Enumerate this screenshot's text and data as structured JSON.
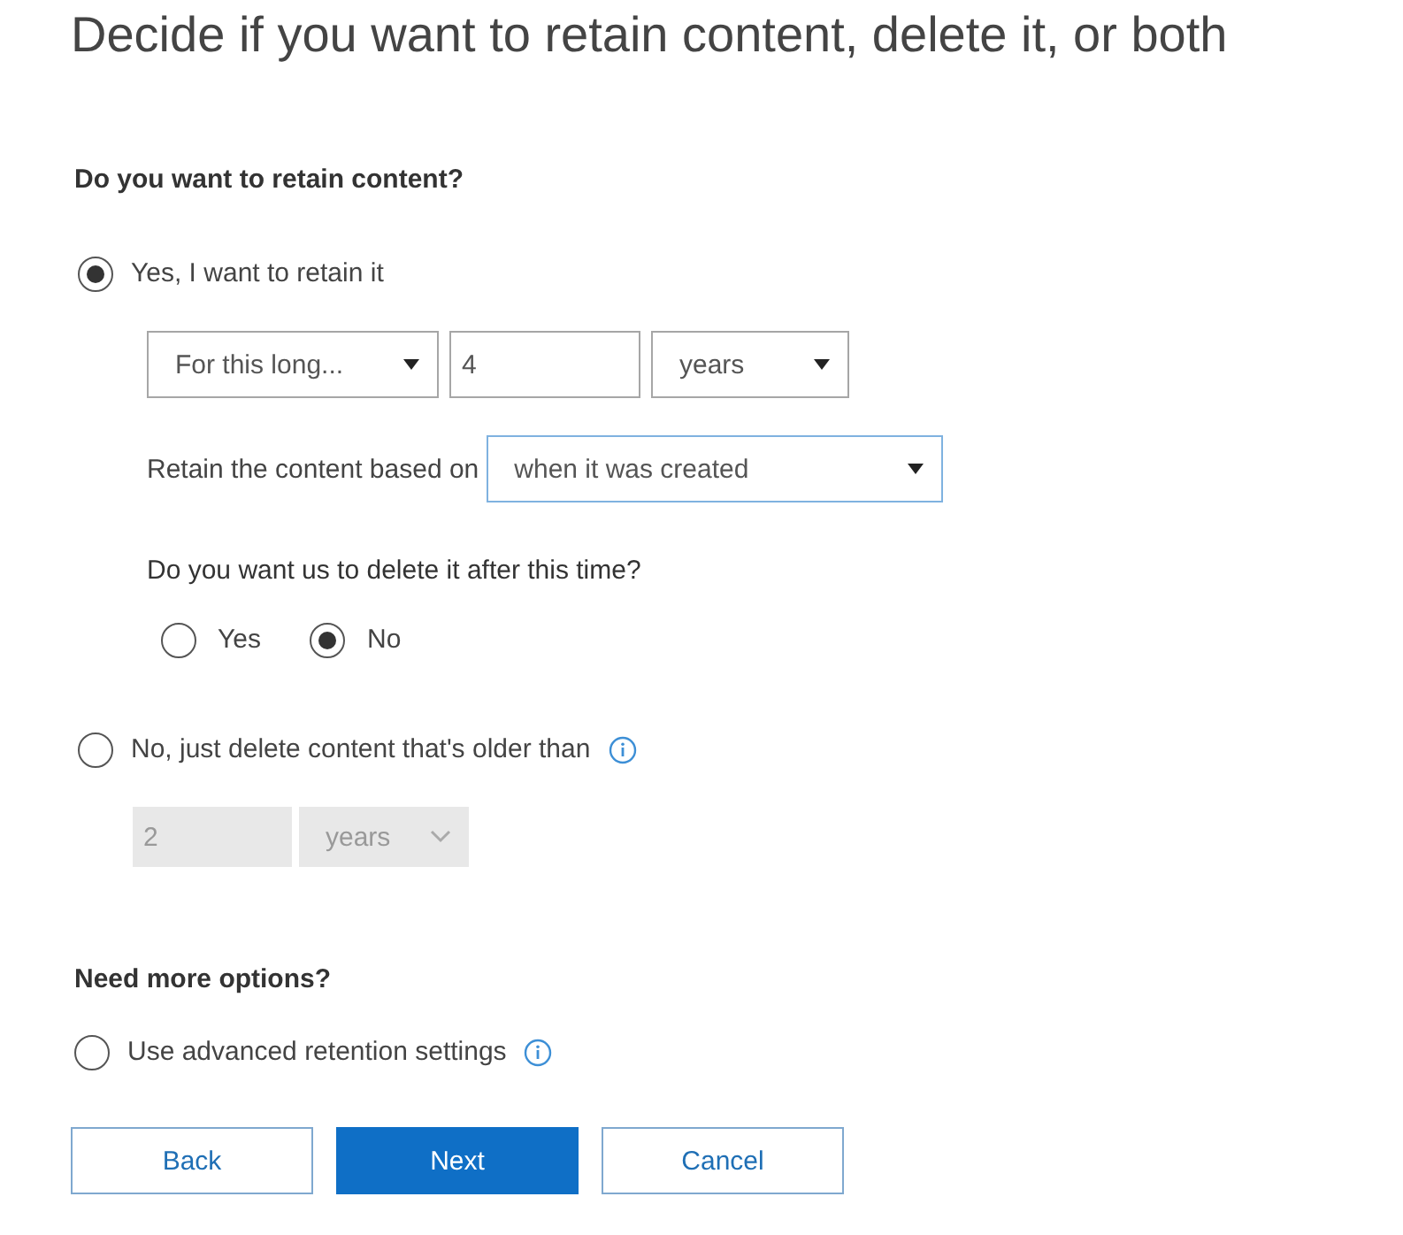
{
  "title": "Decide if you want to retain content, delete it, or both",
  "retain": {
    "heading": "Do you want to retain content?",
    "options": [
      {
        "kind": "retain",
        "label": "Yes, I want to retain it",
        "selected": true,
        "info": false,
        "period": {
          "mode": "For this long...",
          "value": "4",
          "unit": "years"
        },
        "based_on": {
          "label": "Retain the content based on",
          "value": "when it was created"
        },
        "delete_question": "Do you want us to delete it after this time?",
        "delete_choices": [
          {
            "label": "Yes",
            "selected": false
          },
          {
            "label": "No",
            "selected": true
          }
        ]
      },
      {
        "kind": "delete",
        "label": "No, just delete content that's older than",
        "selected": false,
        "info": true,
        "fields": [
          {
            "kind": "input",
            "value": "2",
            "disabled": true
          },
          {
            "kind": "select",
            "value": "years",
            "disabled": true
          }
        ]
      }
    ]
  },
  "more": {
    "heading": "Need more options?",
    "options": [
      {
        "label": "Use advanced retention settings",
        "selected": false,
        "info": true
      }
    ]
  },
  "buttons": [
    {
      "label": "Back",
      "kind": "secondary"
    },
    {
      "label": "Next",
      "kind": "primary"
    },
    {
      "label": "Cancel",
      "kind": "secondary"
    }
  ]
}
